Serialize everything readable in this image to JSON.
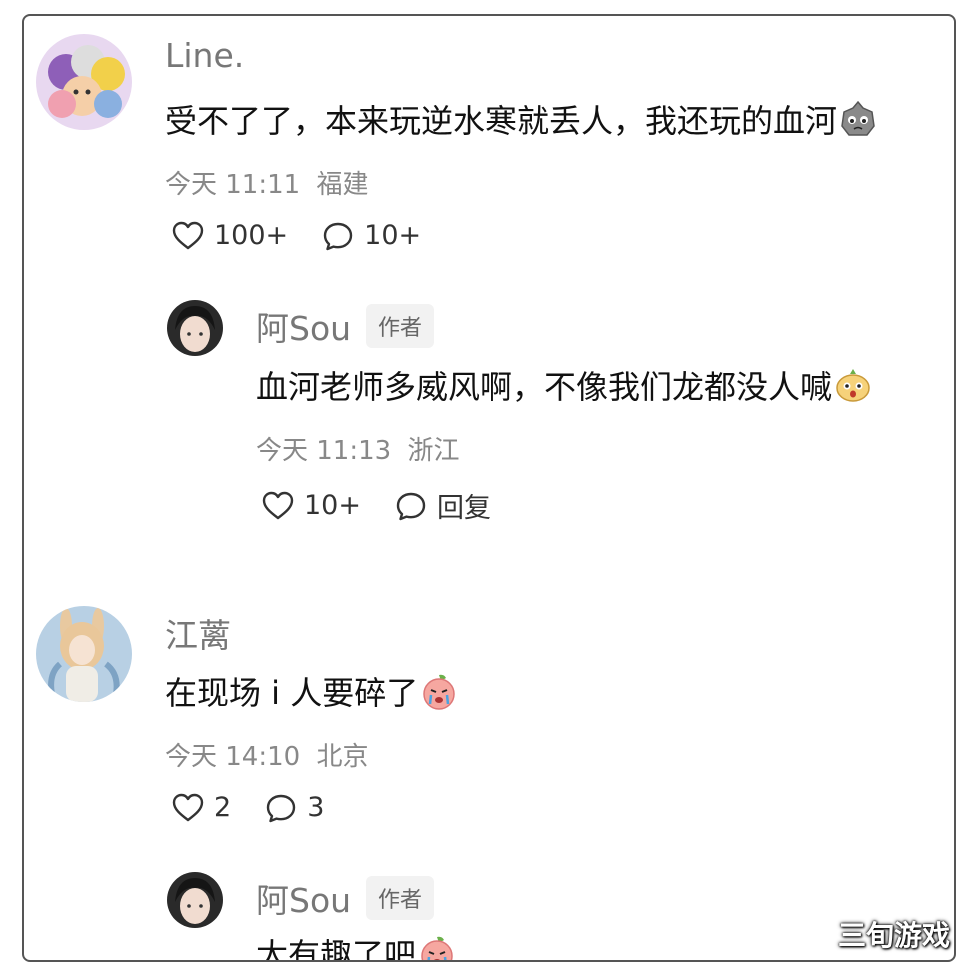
{
  "comments": [
    {
      "user": "Line.",
      "text": "受不了了，本来玩逆水寒就丢人，我还玩的血河",
      "emoji": "crying-rock-emoji",
      "time": "今天 11:11",
      "location": "福建",
      "likes": "100+",
      "replies": "10+"
    },
    {
      "user": "阿Sou",
      "badge": "作者",
      "text": "血河老师多威风啊，不像我们龙都没人喊",
      "emoji": "shocked-bun-emoji",
      "time": "今天 11:13",
      "location": "浙江",
      "likes": "10+",
      "reply_label": "回复"
    },
    {
      "user": "江蓠",
      "text": "在现场 i 人要碎了",
      "emoji": "crying-peach-emoji",
      "time": "今天 14:10",
      "location": "北京",
      "likes": "2",
      "replies": "3"
    },
    {
      "user": "阿Sou",
      "badge": "作者",
      "text": "太有趣了吧",
      "emoji": "crying-peach-emoji"
    }
  ],
  "watermark": "三旬游戏"
}
